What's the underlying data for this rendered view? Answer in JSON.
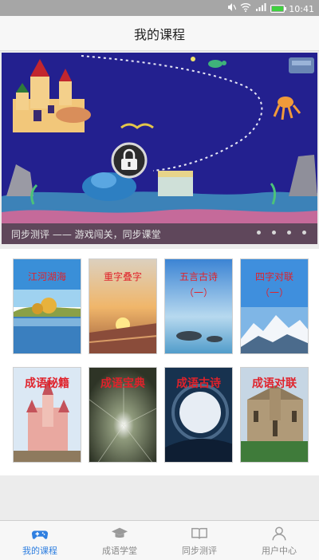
{
  "status_bar": {
    "time": "10:41"
  },
  "header": {
    "title": "我的课程"
  },
  "banner": {
    "caption": "同步测评 —— 游戏闯关，同步课堂",
    "slide_count": 4,
    "active_slide": 4
  },
  "courses": [
    {
      "label": "江河湖海",
      "line2": ""
    },
    {
      "label": "重字叠字",
      "line2": ""
    },
    {
      "label": "五言古诗",
      "line2": "（一）"
    },
    {
      "label": "四字对联",
      "line2": "（一）"
    },
    {
      "label": "成语秘籍",
      "line2": ""
    },
    {
      "label": "成语宝典",
      "line2": ""
    },
    {
      "label": "成语古诗",
      "line2": ""
    },
    {
      "label": "成语对联",
      "line2": ""
    }
  ],
  "tabs": [
    {
      "label": "我的课程",
      "icon": "gamepad-icon",
      "active": true
    },
    {
      "label": "成语学堂",
      "icon": "graduation-cap-icon",
      "active": false
    },
    {
      "label": "同步测评",
      "icon": "open-book-icon",
      "active": false
    },
    {
      "label": "用户中心",
      "icon": "user-icon",
      "active": false
    }
  ],
  "colors": {
    "accent": "#2f7fe0",
    "card_text": "#e0222b",
    "banner_sea": "#1f1f8c"
  }
}
